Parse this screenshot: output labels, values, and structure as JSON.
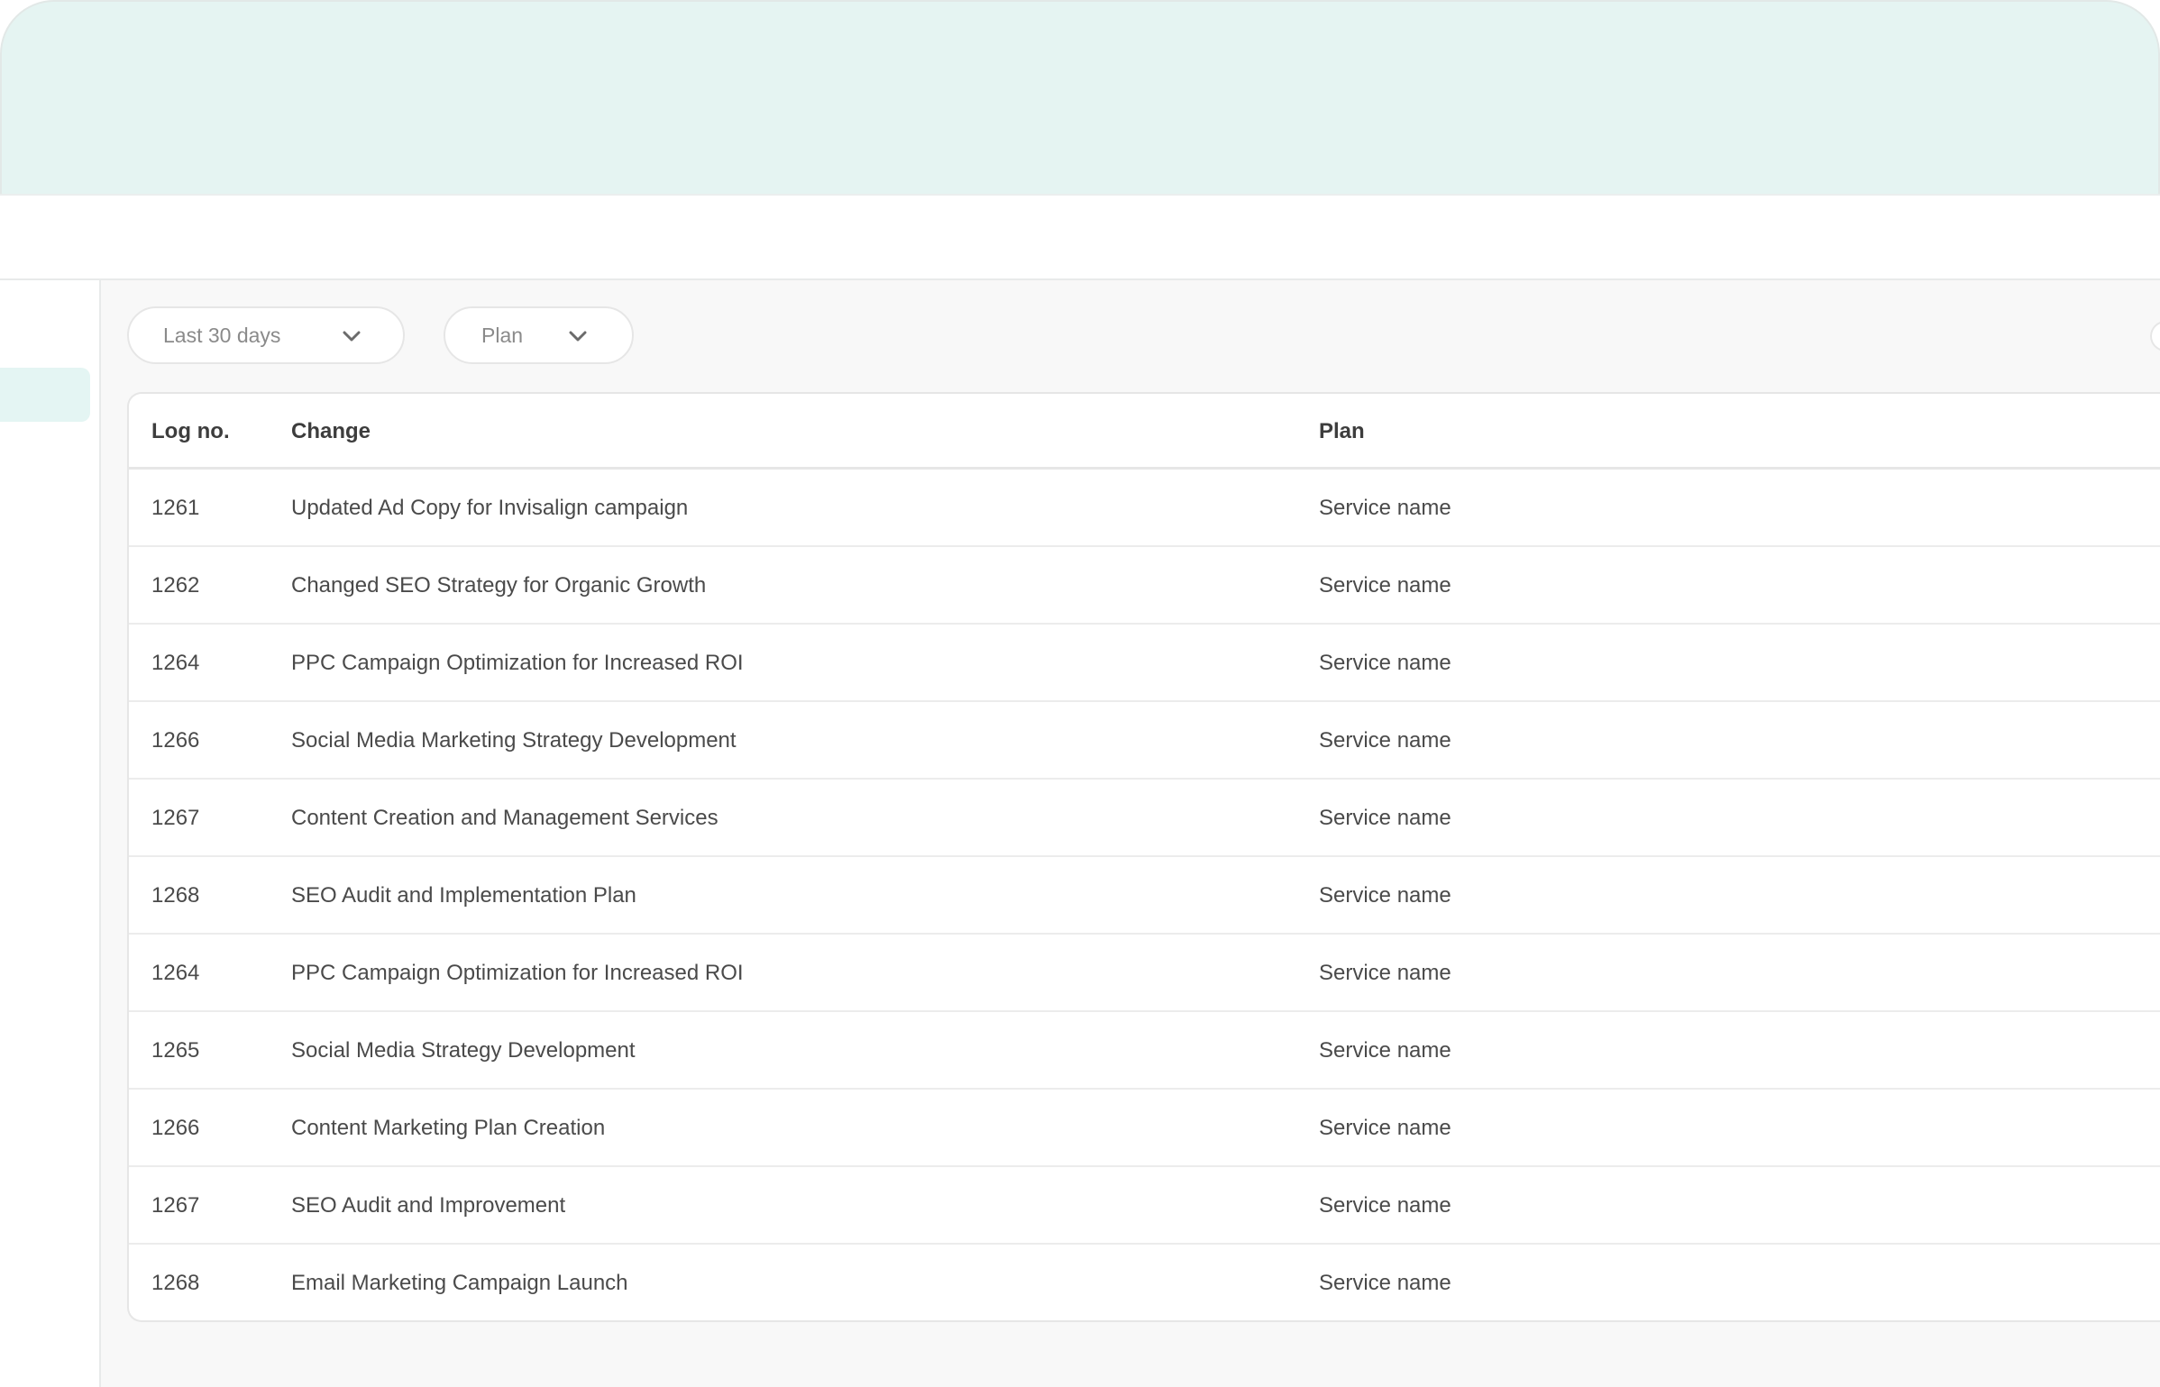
{
  "filters": {
    "date_range": {
      "selected": "Last 30 days",
      "icon": "chevron-down-icon"
    },
    "plan": {
      "selected": "Plan",
      "icon": "chevron-down-icon"
    }
  },
  "table": {
    "columns": {
      "log_no": "Log no.",
      "change": "Change",
      "plan": "Plan"
    },
    "rows": [
      {
        "log_no": "1261",
        "change": "Updated Ad Copy for Invisalign campaign",
        "plan": "Service name"
      },
      {
        "log_no": "1262",
        "change": "Changed SEO Strategy for Organic Growth",
        "plan": "Service name"
      },
      {
        "log_no": "1264",
        "change": "PPC Campaign Optimization for Increased ROI",
        "plan": "Service name"
      },
      {
        "log_no": "1266",
        "change": "Social Media Marketing Strategy Development",
        "plan": "Service name"
      },
      {
        "log_no": "1267",
        "change": "Content Creation and Management Services",
        "plan": "Service name"
      },
      {
        "log_no": "1268",
        "change": "SEO Audit and Implementation Plan",
        "plan": "Service name"
      },
      {
        "log_no": "1264",
        "change": "PPC Campaign Optimization for Increased ROI",
        "plan": "Service name"
      },
      {
        "log_no": "1265",
        "change": "Social Media Strategy Development",
        "plan": "Service name"
      },
      {
        "log_no": "1266",
        "change": "Content Marketing Plan Creation",
        "plan": "Service name"
      },
      {
        "log_no": "1267",
        "change": "SEO Audit and Improvement",
        "plan": "Service name"
      },
      {
        "log_no": "1268",
        "change": "Email Marketing Campaign Launch",
        "plan": "Service name"
      }
    ]
  }
}
